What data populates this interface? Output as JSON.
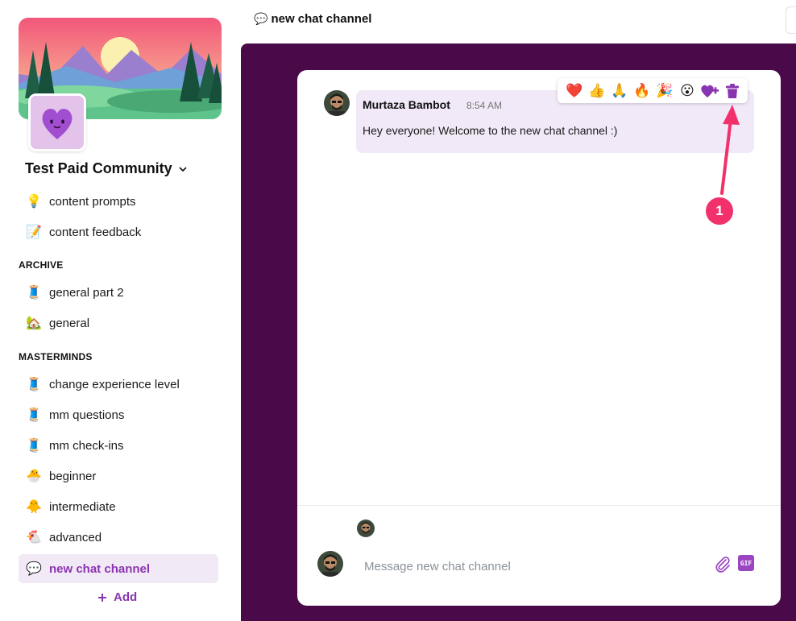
{
  "header": {
    "title": "new chat channel",
    "icon": "speech-bubble-icon"
  },
  "community": {
    "name": "Test Paid Community"
  },
  "sidebar": {
    "top_items": [
      {
        "emoji": "💡",
        "label": "content prompts"
      },
      {
        "emoji": "📝",
        "label": "content feedback"
      }
    ],
    "sections": [
      {
        "label": "ARCHIVE",
        "items": [
          {
            "emoji": "🧵",
            "label": "general part 2"
          },
          {
            "emoji": "🏡",
            "label": "general"
          }
        ]
      },
      {
        "label": "MASTERMINDS",
        "items": [
          {
            "emoji": "🧵",
            "label": "change experience level"
          },
          {
            "emoji": "🧵",
            "label": "mm questions"
          },
          {
            "emoji": "🧵",
            "label": "mm check-ins"
          },
          {
            "emoji": "🐣",
            "label": "beginner"
          },
          {
            "emoji": "🐥",
            "label": "intermediate"
          },
          {
            "emoji": "🐔",
            "label": "advanced"
          },
          {
            "emoji": "💬",
            "label": "new chat channel"
          }
        ]
      }
    ],
    "add_label": "Add"
  },
  "message": {
    "author": "Murtaza Bambot",
    "time": "8:54 AM",
    "text": "Hey everyone! Welcome to the new chat channel :)"
  },
  "reactions": [
    "❤️",
    "👍",
    "🙏",
    "🔥",
    "🎉",
    "😮"
  ],
  "annotation": {
    "number": "1"
  },
  "composer": {
    "placeholder": "Message new chat channel",
    "gif_label": "GIF"
  },
  "colors": {
    "accent": "#8a35b0",
    "main_bg": "#4a0a4a",
    "bubble": "#f1e9f7",
    "annotation": "#f2306b"
  }
}
